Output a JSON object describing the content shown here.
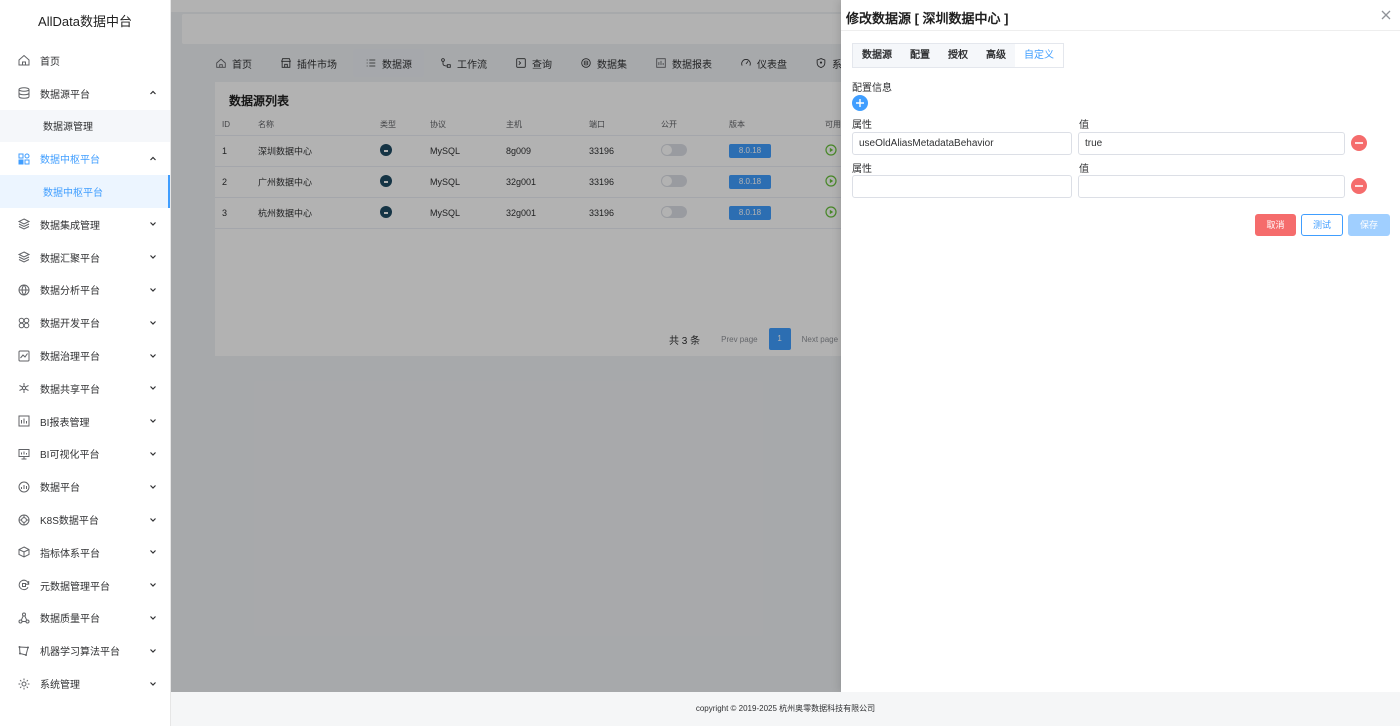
{
  "brand": "AllData数据中台",
  "sidebar": {
    "items": [
      {
        "label": "首页",
        "icon": "home-icon",
        "expandable": false
      },
      {
        "label": "数据源平台",
        "icon": "database-icon",
        "expandable": true,
        "expanded": true
      },
      {
        "label": "数据中枢平台",
        "icon": "hub-icon",
        "expandable": true,
        "expanded": true,
        "active": true
      },
      {
        "label": "数据集成管理",
        "icon": "layers-icon",
        "expandable": true
      },
      {
        "label": "数据汇聚平台",
        "icon": "layers-icon",
        "expandable": true
      },
      {
        "label": "数据分析平台",
        "icon": "globe-icon",
        "expandable": true
      },
      {
        "label": "数据开发平台",
        "icon": "grid-icon",
        "expandable": true
      },
      {
        "label": "数据治理平台",
        "icon": "chart-line-icon",
        "expandable": true
      },
      {
        "label": "数据共享平台",
        "icon": "share-icon",
        "expandable": true
      },
      {
        "label": "BI报表管理",
        "icon": "report-icon",
        "expandable": true
      },
      {
        "label": "BI可视化平台",
        "icon": "monitor-icon",
        "expandable": true
      },
      {
        "label": "数据平台",
        "icon": "dashboard-icon",
        "expandable": true
      },
      {
        "label": "K8S数据平台",
        "icon": "k8s-icon",
        "expandable": true
      },
      {
        "label": "指标体系平台",
        "icon": "cube-icon",
        "expandable": true
      },
      {
        "label": "元数据管理平台",
        "icon": "refresh-icon",
        "expandable": true
      },
      {
        "label": "数据质量平台",
        "icon": "nodes-icon",
        "expandable": true
      },
      {
        "label": "机器学习算法平台",
        "icon": "algorithm-icon",
        "expandable": true
      },
      {
        "label": "系统管理",
        "icon": "gear-icon",
        "expandable": true
      }
    ],
    "sub_datasource": "数据源管理",
    "sub_hub": "数据中枢平台"
  },
  "tabs": [
    {
      "label": "首页",
      "icon": "home-icon"
    },
    {
      "label": "插件市场",
      "icon": "store-icon"
    },
    {
      "label": "数据源",
      "icon": "list-icon",
      "active": true
    },
    {
      "label": "工作流",
      "icon": "workflow-icon"
    },
    {
      "label": "查询",
      "icon": "terminal-icon"
    },
    {
      "label": "数据集",
      "icon": "dataset-icon"
    },
    {
      "label": "数据报表",
      "icon": "report-icon"
    },
    {
      "label": "仪表盘",
      "icon": "gauge-icon"
    },
    {
      "label": "系统",
      "icon": "shield-icon"
    }
  ],
  "list": {
    "title": "数据源列表",
    "columns": [
      "ID",
      "名称",
      "类型",
      "协议",
      "主机",
      "端口",
      "公开",
      "版本",
      "可用"
    ],
    "rows": [
      {
        "id": "1",
        "name": "深圳数据中心",
        "protocol": "MySQL",
        "host": "8g009",
        "port": "33196",
        "version": "8.0.18"
      },
      {
        "id": "2",
        "name": "广州数据中心",
        "protocol": "MySQL",
        "host": "32g001",
        "port": "33196",
        "version": "8.0.18"
      },
      {
        "id": "3",
        "name": "杭州数据中心",
        "protocol": "MySQL",
        "host": "32g001",
        "port": "33196",
        "version": "8.0.18"
      }
    ],
    "pager": {
      "total": "共 3 条",
      "prev": "Prev page",
      "page": "1",
      "next": "Next page"
    }
  },
  "drawer": {
    "title": "修改数据源 [ 深圳数据中心 ]",
    "tabs": [
      "数据源",
      "配置",
      "授权",
      "高级",
      "自定义"
    ],
    "active_tab": "自定义",
    "section": "配置信息",
    "attr_label": "属性",
    "value_label": "值",
    "rows": [
      {
        "attr": "useOldAliasMetadataBehavior",
        "value": "true"
      },
      {
        "attr": "",
        "value": ""
      }
    ],
    "buttons": {
      "cancel": "取消",
      "test": "测试",
      "save": "保存"
    }
  },
  "footer": "copyright © 2019-2025 杭州奥零数据科技有限公司",
  "colors": {
    "primary": "#409eff",
    "danger": "#f56c6c",
    "disabled": "#a0cfff"
  }
}
